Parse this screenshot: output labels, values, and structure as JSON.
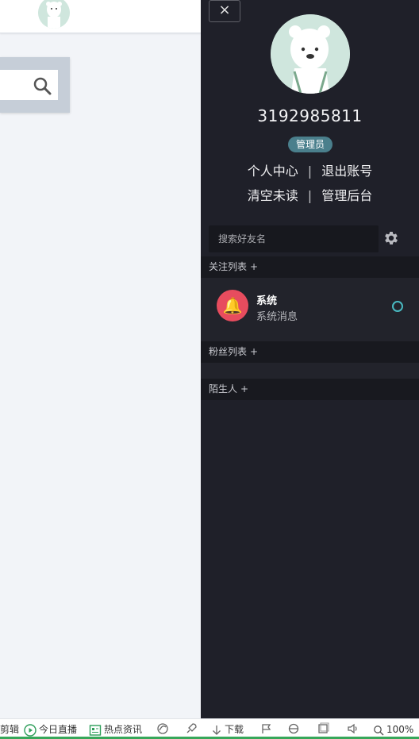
{
  "panel": {
    "close_label": "×",
    "user_id": "3192985811",
    "role": "管理员",
    "links_row1": [
      "个人中心",
      "退出账号"
    ],
    "links_row2": [
      "清空未读",
      "管理后台"
    ],
    "separator": "|",
    "search_placeholder": "搜索好友名",
    "sections": {
      "follow": "关注列表",
      "fans": "粉丝列表",
      "strangers": "陌生人",
      "plus": "+"
    },
    "contact": {
      "name": "系统",
      "message": "系统消息"
    }
  },
  "statusbar": {
    "items": [
      "剪辑",
      "今日直播",
      "热点资讯",
      "下载",
      "100%"
    ]
  },
  "colors": {
    "panel_bg": "#1f2029",
    "badge": "#4a7f8c",
    "bell_avatar": "#e74c5e",
    "online": "#49b9c1"
  },
  "icons": [
    "search-icon",
    "close-icon",
    "gear-icon",
    "bell-icon",
    "play-icon",
    "news-icon",
    "download-icon",
    "volume-icon",
    "zoom-icon"
  ]
}
